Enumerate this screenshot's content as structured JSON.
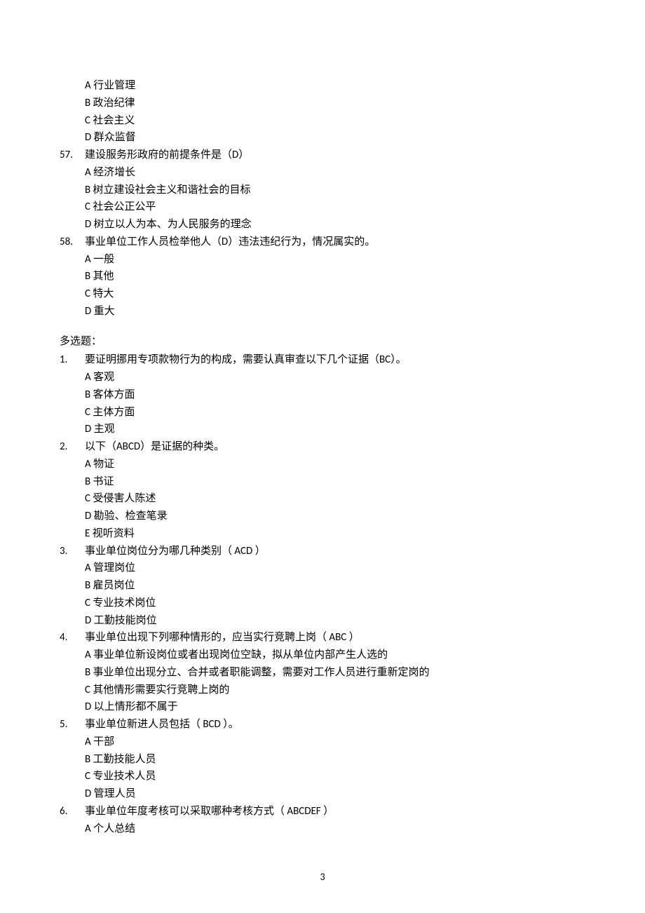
{
  "page_number": "3",
  "top_options": [
    "A 行业管理",
    "B 政治纪律",
    "C 社会主义",
    "D 群众监督"
  ],
  "single_questions": [
    {
      "num": "57.",
      "stem": "建设服务形政府的前提条件是（D）",
      "options": [
        "A 经济增长",
        "B 树立建设社会主义和谐社会的目标",
        "C 社会公正公平",
        "D 树立以人为本、为人民服务的理念"
      ]
    },
    {
      "num": "58.",
      "stem": "事业单位工作人员检举他人（D）违法违纪行为，情况属实的。",
      "options": [
        "A 一般",
        "B 其他",
        "C 特大",
        "D 重大"
      ]
    }
  ],
  "multi_header": "多选题：",
  "multi_questions": [
    {
      "num": "1.",
      "stem": "要证明挪用专项款物行为的构成，需要认真审查以下几个证据（BC）。",
      "options": [
        "A 客观",
        "B 客体方面",
        "C 主体方面",
        "D 主观"
      ]
    },
    {
      "num": "2.",
      "stem": "以下（ABCD）是证据的种类。",
      "options": [
        "A 物证",
        "B 书证",
        "C 受侵害人陈述",
        "D 勘验、检查笔录",
        "E 视听资料"
      ]
    },
    {
      "num": "3.",
      "stem": "事业单位岗位分为哪几种类别（ ACD  ）",
      "options": [
        "A 管理岗位",
        "B 雇员岗位",
        "C 专业技术岗位",
        "D 工勤技能岗位"
      ]
    },
    {
      "num": "4.",
      "stem": "事业单位出现下列哪种情形的，应当实行竞聘上岗（ ABC  ）",
      "options": [
        "A 事业单位新设岗位或者出现岗位空缺，拟从单位内部产生人选的",
        "B 事业单位出现分立、合并或者职能调整，需要对工作人员进行重新定岗的",
        "C 其他情形需要实行竞聘上岗的",
        "D 以上情形都不属于"
      ]
    },
    {
      "num": "5.",
      "stem": "事业单位新进人员包括（ BCD  ）。",
      "options": [
        "A 干部",
        "B 工勤技能人员",
        "C 专业技术人员",
        "D 管理人员"
      ]
    },
    {
      "num": "6.",
      "stem": "事业单位年度考核可以采取哪种考核方式（ ABCDEF  ）",
      "options": [
        "A 个人总结"
      ]
    }
  ]
}
